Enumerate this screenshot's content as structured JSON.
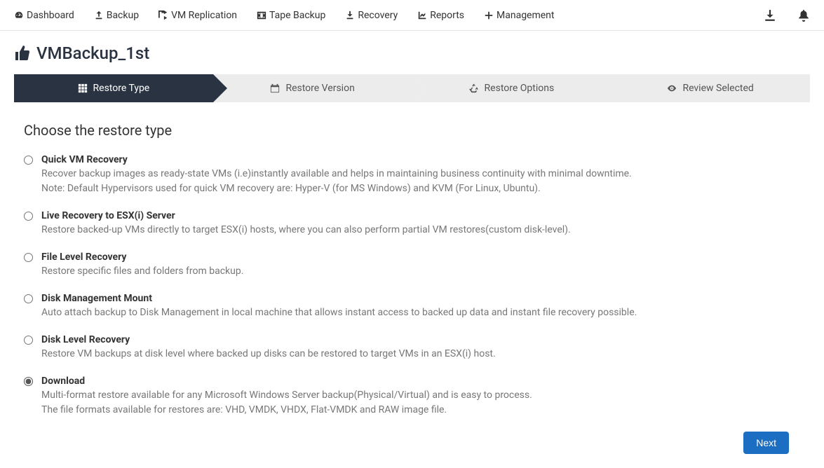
{
  "nav": {
    "items": [
      {
        "label": "Dashboard"
      },
      {
        "label": "Backup"
      },
      {
        "label": "VM Replication"
      },
      {
        "label": "Tape Backup"
      },
      {
        "label": "Recovery"
      },
      {
        "label": "Reports"
      },
      {
        "label": "Management"
      }
    ]
  },
  "page": {
    "title": "VMBackup_1st"
  },
  "wizard": {
    "steps": [
      {
        "label": "Restore Type",
        "active": true
      },
      {
        "label": "Restore Version",
        "active": false
      },
      {
        "label": "Restore Options",
        "active": false
      },
      {
        "label": "Review Selected",
        "active": false
      }
    ]
  },
  "section": {
    "heading": "Choose the restore type"
  },
  "restore_options": [
    {
      "title": "Quick VM Recovery",
      "desc": "Recover backup images as ready-state VMs (i.e)instantly available and helps in maintaining business continuity with minimal downtime.\nNote: Default Hypervisors used for quick VM recovery are: Hyper-V (for MS Windows) and KVM (For Linux, Ubuntu).",
      "selected": false
    },
    {
      "title": "Live Recovery to ESX(i) Server",
      "desc": "Restore backed-up VMs directly to target ESX(i) hosts, where you can also perform partial VM restores(custom disk-level).",
      "selected": false
    },
    {
      "title": "File Level Recovery",
      "desc": "Restore specific files and folders from backup.",
      "selected": false
    },
    {
      "title": "Disk Management Mount",
      "desc": "Auto attach backup to Disk Management in local machine that allows instant access to backed up data and instant file recovery possible.",
      "selected": false
    },
    {
      "title": "Disk Level Recovery",
      "desc": "Restore VM backups at disk level where backed up disks can be restored to target VMs in an ESX(i) host.",
      "selected": false
    },
    {
      "title": "Download",
      "desc": "Multi-format restore available for any Microsoft Windows Server backup(Physical/Virtual) and is easy to process.\nThe file formats available for restores are: VHD, VMDK, VHDX, Flat-VMDK and RAW image file.",
      "selected": true
    }
  ],
  "footer": {
    "next_label": "Next"
  }
}
